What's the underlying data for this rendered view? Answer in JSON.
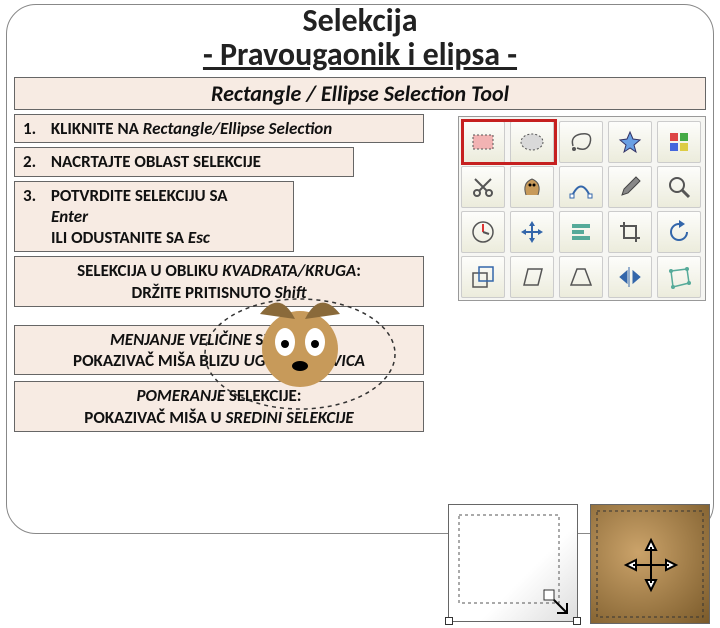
{
  "title": {
    "line1": "Selekcija",
    "line2": "- Pravougaonik i elipsa -"
  },
  "subtitle": "Rectangle / Ellipse Selection Tool",
  "steps": {
    "s1_num": "1.",
    "s1_text": "KLIKNITE NA ",
    "s1_em": "Rectangle/Ellipse Selection",
    "s2_num": "2.",
    "s2_text": "NACRTAJTE OBLAST SELEKCIJE",
    "s3_num": "3.",
    "s3_text": "POTVRDITE SELEKCIJU SA",
    "s3_em1": "Enter",
    "s3_text2": "ILI ODUSTANITE SA ",
    "s3_em2": "Esc"
  },
  "note_square": {
    "line1a": "SELEKCIJA U OBLIKU ",
    "line1b": "KVADRATA/KRUGA",
    "line1c": ":",
    "line2a": "DRŽITE PRITISNUTO ",
    "line2b": "Shift"
  },
  "note_resize": {
    "line1a": "MENJANJE VELIČINE",
    "line1b": " SELEKCIJE:",
    "line2a": "POKAZIVAČ MIŠA BLIZU ",
    "line2b": "UGLOVA ILI IVICA"
  },
  "note_move": {
    "line1a": "POMERANJE",
    "line1b": " SELEKCIJE:",
    "line2a": "POKAZIVAČ MIŠA U ",
    "line2b": "SREDINI SELEKCIJE"
  },
  "tools": [
    "rect-select-icon",
    "ellipse-select-icon",
    "lasso-icon",
    "fuzzy-select-icon",
    "color-select-icon",
    "scissors-icon",
    "foreground-select-icon",
    "paths-icon",
    "color-picker-icon",
    "zoom-icon",
    "measure-icon",
    "move-icon",
    "align-icon",
    "crop-icon",
    "rotate-icon",
    "scale-icon",
    "shear-icon",
    "perspective-icon",
    "flip-icon",
    "cage-icon"
  ]
}
